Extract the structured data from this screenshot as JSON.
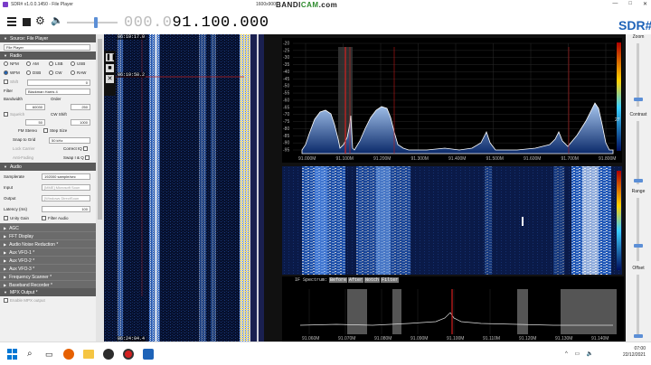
{
  "window": {
    "title": "SDR# v1.0.0.1450 - File Player",
    "resolution": "1600x900",
    "recorder_brand_a": "BANDI",
    "recorder_brand_b": "CAM",
    "recorder_suffix": ".com",
    "controls": [
      "—",
      "□",
      "✕"
    ]
  },
  "toolbar": {
    "frequency_dim": "000.0",
    "frequency_bright": "91.100.000",
    "frequency_unit": "◂",
    "logo": "SDR#"
  },
  "panel": {
    "source_header": "Source: File Player",
    "source_select": "File Player",
    "radio_header": "Radio",
    "modes": [
      {
        "label": "NFM",
        "on": false
      },
      {
        "label": "AM",
        "on": false
      },
      {
        "label": "LSB",
        "on": false
      },
      {
        "label": "USB",
        "on": false
      },
      {
        "label": "WFM",
        "on": true
      },
      {
        "label": "DSB",
        "on": false
      },
      {
        "label": "CW",
        "on": false
      },
      {
        "label": "RAW",
        "on": false
      }
    ],
    "shift_label": "Shift",
    "shift_value": "0",
    "filter_label": "Filter",
    "filter_value": "Blackman Harris 4",
    "bandwidth_label": "Bandwidth",
    "order_label": "Order",
    "bandwidth_value": "60030",
    "order_value": "250",
    "squelch_label": "Squelch",
    "cw_shift_label": "CW Shift",
    "squelch_value": "50",
    "cw_shift_value": "1000",
    "fm_stereo_label": "FM Stereo",
    "step_size_label": "Step Size",
    "snap_label": "Snap to Grid",
    "snap_value": "50 kHz",
    "lock_carrier_label": "Lock Carrier",
    "correct_iq_label": "Correct IQ",
    "anti_fading_label": "Anti-Fading",
    "swap_iq_label": "Swap I & Q",
    "audio_header": "Audio",
    "samplerate_label": "Samplerate",
    "samplerate_value": "192000 sample/sec",
    "input_label": "Input",
    "input_value": "[MME] Microsoft Soun",
    "output_label": "Output",
    "output_value": "[Windows DirectSoun",
    "latency_label": "Latency (ms)",
    "latency_value": "100",
    "unity_gain_label": "Unity Gain",
    "filter_audio_label": "Filter Audio",
    "plugins": [
      "AGC",
      "FFT Display",
      "Audio Noise Reduction *",
      "Aux VFO-1 *",
      "Aux VFO-2 *",
      "Aux VFO-3 *",
      "Frequency Scanner *",
      "Baseband Recorder *",
      "MPX Output *"
    ],
    "mpx_item": "Enable MPX output"
  },
  "waterfall_left": {
    "time_top": "06:19:17.0",
    "time_mid": "06:19:58.2",
    "time_bottom": "06:24:04.4"
  },
  "spectrum": {
    "db_labels": [
      "-20",
      "-25",
      "-30",
      "-35",
      "-40",
      "-45",
      "-50",
      "-55",
      "-60",
      "-65",
      "-70",
      "-75",
      "-80",
      "-85",
      "-90",
      "-95"
    ],
    "freq_labels": [
      "91.000M",
      "91.100M",
      "91.200M",
      "91.300M",
      "91.400M",
      "91.500M",
      "91.600M",
      "91.700M",
      "91.800M"
    ],
    "gradient_value": "27"
  },
  "if_spectrum": {
    "title": "IF Spectrum:",
    "buttons": [
      "Before",
      "After",
      "Notch",
      "Filter"
    ],
    "freq_labels": [
      "91.060M",
      "91.070M",
      "91.080M",
      "91.090M",
      "91.100M",
      "91.110M",
      "91.120M",
      "91.130M",
      "91.140M"
    ]
  },
  "zoom": {
    "zoom_label": "Zoom",
    "contrast_label": "Contrast",
    "range_label": "Range",
    "offset_label": "Offset"
  },
  "taskbar": {
    "time": "07:00",
    "date": "22/12/2021"
  }
}
